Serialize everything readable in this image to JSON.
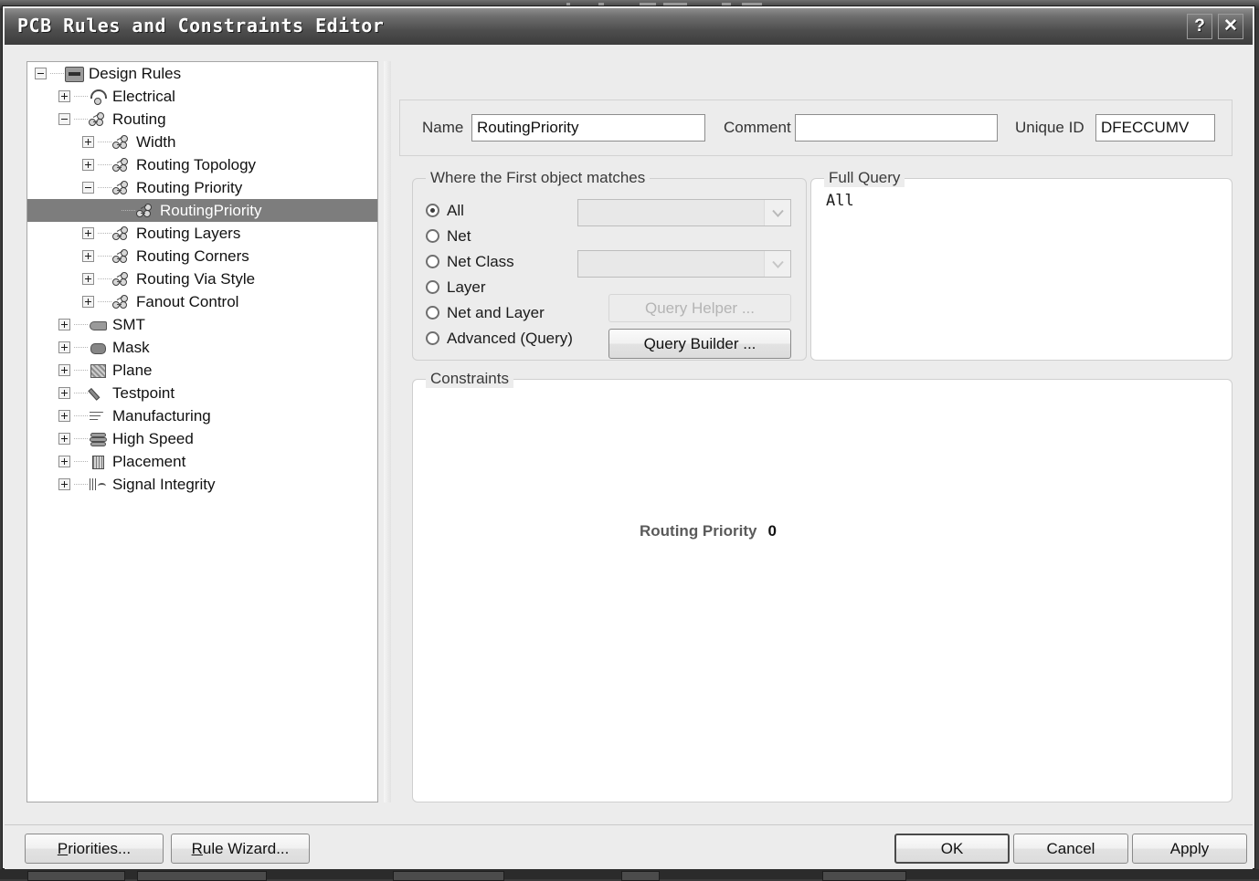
{
  "window": {
    "title": "PCB Rules and Constraints Editor",
    "help_button": "?",
    "close_button": "✕"
  },
  "tree": {
    "items": [
      {
        "label": "Design Rules",
        "depth": 0,
        "state": "expanded",
        "icon": "design-rules-folder-icon",
        "selected": false
      },
      {
        "label": "Electrical",
        "depth": 1,
        "state": "collapsed",
        "icon": "electrical-icon",
        "selected": false
      },
      {
        "label": "Routing",
        "depth": 1,
        "state": "expanded",
        "icon": "routing-net-icon",
        "selected": false
      },
      {
        "label": "Width",
        "depth": 2,
        "state": "collapsed",
        "icon": "routing-net-icon",
        "selected": false
      },
      {
        "label": "Routing Topology",
        "depth": 2,
        "state": "collapsed",
        "icon": "routing-net-icon",
        "selected": false
      },
      {
        "label": "Routing Priority",
        "depth": 2,
        "state": "expanded",
        "icon": "routing-net-icon",
        "selected": false
      },
      {
        "label": "RoutingPriority",
        "depth": 3,
        "state": "leaf",
        "icon": "routing-net-icon",
        "selected": true
      },
      {
        "label": "Routing Layers",
        "depth": 2,
        "state": "collapsed",
        "icon": "routing-net-icon",
        "selected": false
      },
      {
        "label": "Routing Corners",
        "depth": 2,
        "state": "collapsed",
        "icon": "routing-net-icon",
        "selected": false
      },
      {
        "label": "Routing Via Style",
        "depth": 2,
        "state": "collapsed",
        "icon": "routing-net-icon",
        "selected": false
      },
      {
        "label": "Fanout Control",
        "depth": 2,
        "state": "collapsed",
        "icon": "routing-net-icon",
        "selected": false
      },
      {
        "label": "SMT",
        "depth": 1,
        "state": "collapsed",
        "icon": "smt-icon",
        "selected": false
      },
      {
        "label": "Mask",
        "depth": 1,
        "state": "collapsed",
        "icon": "mask-icon",
        "selected": false
      },
      {
        "label": "Plane",
        "depth": 1,
        "state": "collapsed",
        "icon": "plane-icon",
        "selected": false
      },
      {
        "label": "Testpoint",
        "depth": 1,
        "state": "collapsed",
        "icon": "testpoint-icon",
        "selected": false
      },
      {
        "label": "Manufacturing",
        "depth": 1,
        "state": "collapsed",
        "icon": "manufacturing-icon",
        "selected": false
      },
      {
        "label": "High Speed",
        "depth": 1,
        "state": "collapsed",
        "icon": "high-speed-icon",
        "selected": false
      },
      {
        "label": "Placement",
        "depth": 1,
        "state": "collapsed",
        "icon": "placement-icon",
        "selected": false
      },
      {
        "label": "Signal Integrity",
        "depth": 1,
        "state": "collapsed",
        "icon": "signal-integrity-icon",
        "selected": false
      }
    ]
  },
  "header": {
    "name_label": "Name",
    "name_value": "RoutingPriority",
    "comment_label": "Comment",
    "comment_value": "",
    "comment_placeholder": "",
    "unique_id_label": "Unique ID",
    "unique_id_value": "DFECCUMV"
  },
  "scope": {
    "group_title": "Where the First object matches",
    "options": [
      {
        "label": "All",
        "selected": true
      },
      {
        "label": "Net",
        "selected": false
      },
      {
        "label": "Net Class",
        "selected": false
      },
      {
        "label": "Layer",
        "selected": false
      },
      {
        "label": "Net and Layer",
        "selected": false
      },
      {
        "label": "Advanced (Query)",
        "selected": false
      }
    ],
    "net_combo_value": "",
    "net_class_combo_value": "",
    "query_helper_button": "Query Helper ...",
    "query_builder_button": "Query Builder ..."
  },
  "full_query": {
    "group_title": "Full Query",
    "text": "All"
  },
  "constraints": {
    "group_title": "Constraints",
    "routing_priority_label": "Routing Priority",
    "routing_priority_value": "0"
  },
  "footer": {
    "priorities_button": "Priorities...",
    "priorities_accel": "P",
    "rule_wizard_button": "Rule Wizard...",
    "rule_wizard_accel": "R",
    "ok_button": "OK",
    "cancel_button": "Cancel",
    "apply_button": "Apply"
  },
  "colors": {
    "dialog_background": "#ececec",
    "titlebar_dark": "#3c3c3c",
    "titlebar_light": "#8e8e8e",
    "selection": "#7d7d7d",
    "field_background": "#ffffff",
    "border": "#8d8d8d",
    "disabled_text": "#b4b4b4"
  }
}
